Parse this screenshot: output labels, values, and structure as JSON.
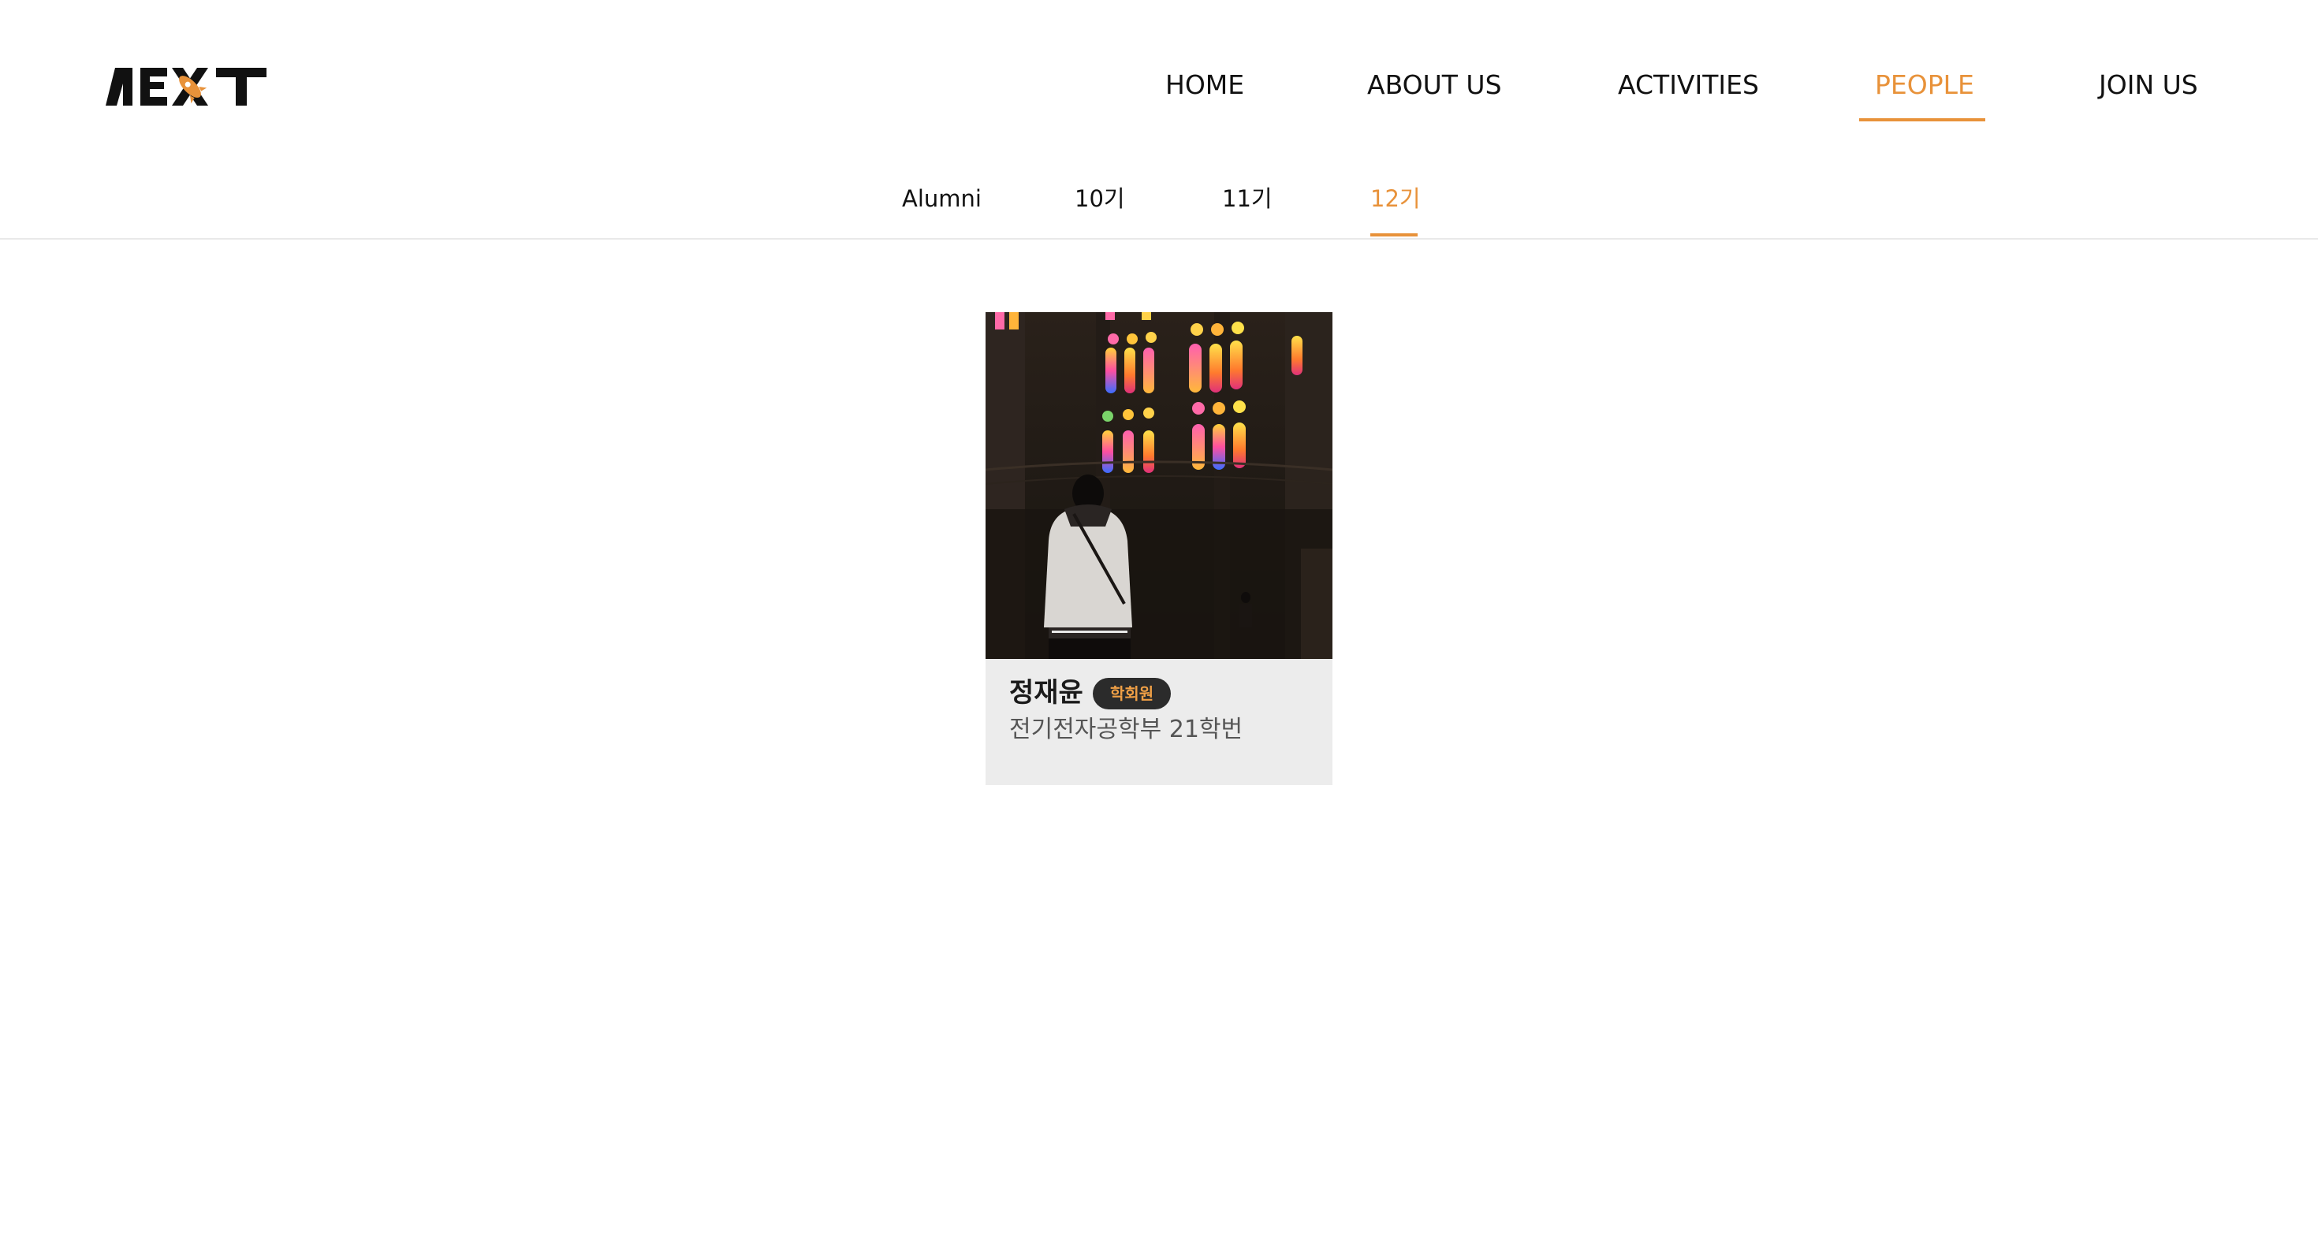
{
  "nav": {
    "items": [
      {
        "label": "HOME"
      },
      {
        "label": "ABOUT US"
      },
      {
        "label": "ACTIVITIES"
      },
      {
        "label": "PEOPLE"
      },
      {
        "label": "JOIN US"
      }
    ],
    "active_index": 3
  },
  "subtabs": {
    "items": [
      {
        "label": "Alumni"
      },
      {
        "label": "10기"
      },
      {
        "label": "11기"
      },
      {
        "label": "12기"
      }
    ],
    "active_index": 3
  },
  "members": [
    {
      "name": "정재윤",
      "role": "학회원",
      "department": "전기전자공학부 21학번"
    }
  ],
  "colors": {
    "accent": "#e8923a",
    "badge_bg": "#2b2b2b",
    "card_bg": "#ececec"
  },
  "icons": {
    "logo": "next-logo-with-rocket-icon"
  }
}
